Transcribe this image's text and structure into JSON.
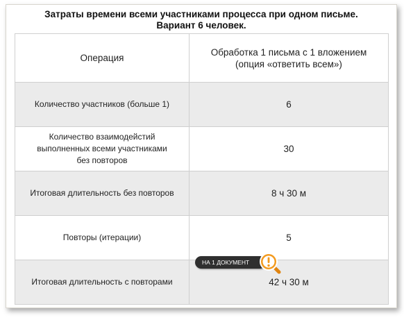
{
  "title": {
    "line1": "Затраты времени всеми участниками процесса при одном письме.",
    "line2": "Вариант 6 человек."
  },
  "table": {
    "header": {
      "operation": "Операция",
      "value": "Обработка 1 письма с 1 вложением (опция «ответить всем»)"
    },
    "rows": [
      {
        "operation": "Количество участников (больше 1)",
        "value": "6"
      },
      {
        "operation": "Количество взаимодейстий выполненных всеми участниками без повторов",
        "value": "30"
      },
      {
        "operation": "Итоговая длительность без повторов",
        "value": "8 ч 30 м"
      },
      {
        "operation": "Повторы (итерации)",
        "value": "5"
      },
      {
        "operation": "Итоговая длительность с повторами",
        "value": "42 ч 30 м"
      }
    ]
  },
  "note": {
    "label": "НА 1 ДОКУМЕНТ",
    "icon": "exclamation-magnifier-icon",
    "accent_color": "#f39a1e"
  }
}
